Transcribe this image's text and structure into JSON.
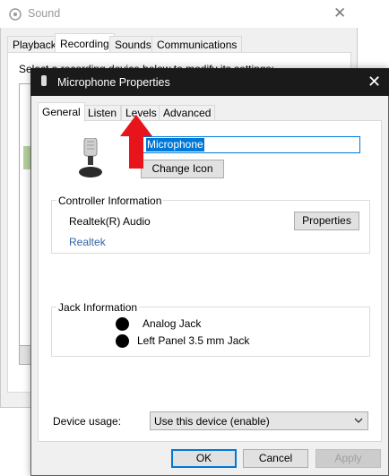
{
  "sound_window": {
    "title": "Sound",
    "tabs": [
      "Playback",
      "Recording",
      "Sounds",
      "Communications"
    ],
    "active_tab": "Recording",
    "description": "Select a recording device below to modify its settings:"
  },
  "dialog": {
    "title": "Microphone Properties",
    "tabs": [
      "General",
      "Listen",
      "Levels",
      "Advanced"
    ],
    "active_tab": "General",
    "device_name": "Microphone",
    "change_icon_label": "Change Icon",
    "controller": {
      "legend": "Controller Information",
      "name": "Realtek(R) Audio",
      "link": "Realtek",
      "properties_label": "Properties"
    },
    "jack": {
      "legend": "Jack Information",
      "items": [
        "Analog Jack",
        "Left Panel 3.5 mm Jack"
      ]
    },
    "device_usage": {
      "label": "Device usage:",
      "value": "Use this device (enable)"
    },
    "buttons": {
      "ok": "OK",
      "cancel": "Cancel",
      "apply": "Apply"
    }
  },
  "colors": {
    "accent": "#0078d7",
    "arrow": "#e8141c",
    "link": "#3466a5",
    "dialog_titlebar": "#1a1a1a"
  },
  "icons": {
    "sound_title": "speaker-icon",
    "dialog_title": "microphone-icon",
    "device": "microphone-icon",
    "annotation": "red-arrow-up-icon"
  }
}
